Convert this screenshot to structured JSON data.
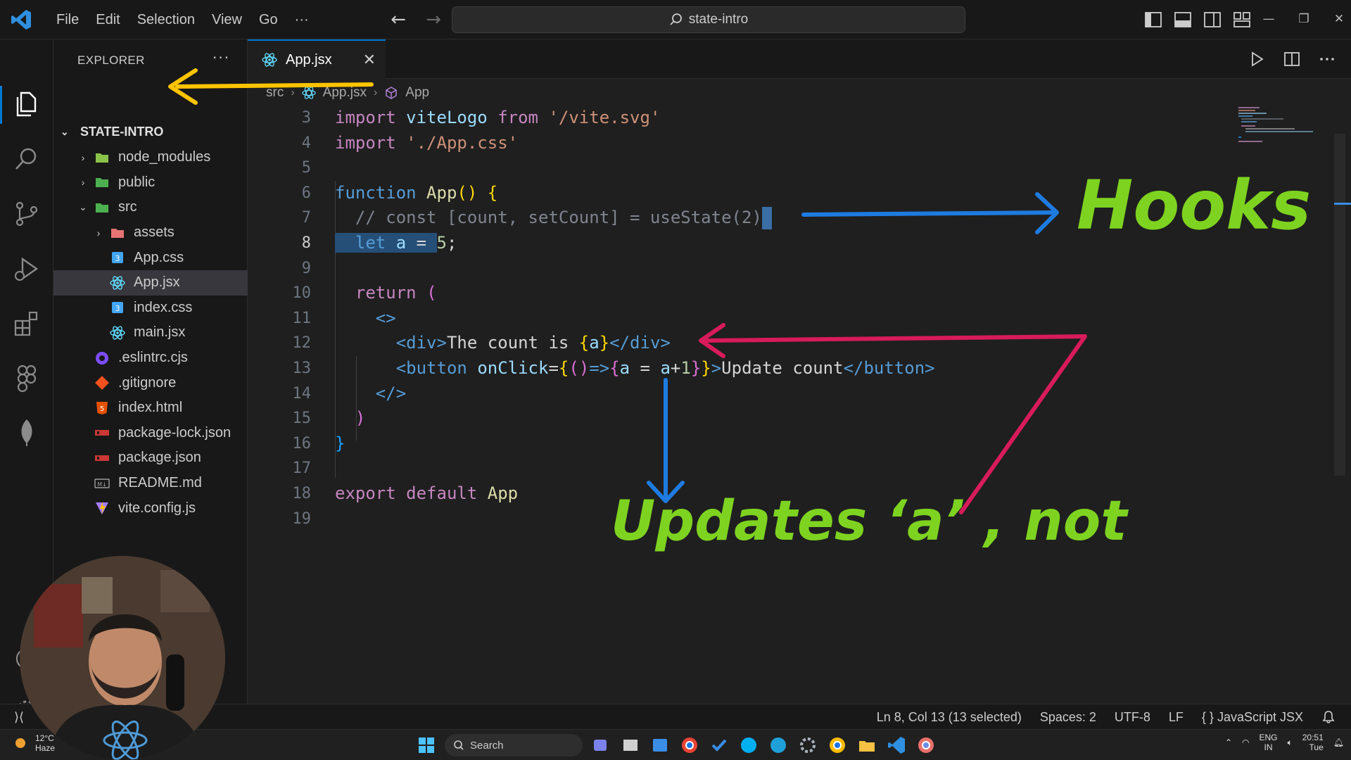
{
  "titlebar": {
    "menu": [
      "File",
      "Edit",
      "Selection",
      "View",
      "Go",
      "···"
    ],
    "search_text": "state-intro"
  },
  "explorer": {
    "title": "EXPLORER",
    "more": "···",
    "root": "STATE-INTRO",
    "items": [
      {
        "label": "node_modules",
        "kind": "folder",
        "depth": 1,
        "expanded": false,
        "icon": "node-modules-folder-icon"
      },
      {
        "label": "public",
        "kind": "folder",
        "depth": 1,
        "expanded": false,
        "icon": "public-folder-icon"
      },
      {
        "label": "src",
        "kind": "folder",
        "depth": 1,
        "expanded": true,
        "icon": "src-folder-icon"
      },
      {
        "label": "assets",
        "kind": "folder",
        "depth": 2,
        "expanded": false,
        "icon": "assets-folder-icon"
      },
      {
        "label": "App.css",
        "kind": "file",
        "depth": 2,
        "icon": "css-file-icon"
      },
      {
        "label": "App.jsx",
        "kind": "file",
        "depth": 2,
        "icon": "react-file-icon",
        "selected": true
      },
      {
        "label": "index.css",
        "kind": "file",
        "depth": 2,
        "icon": "css-file-icon"
      },
      {
        "label": "main.jsx",
        "kind": "file",
        "depth": 2,
        "icon": "react-file-icon"
      },
      {
        "label": ".eslintrc.cjs",
        "kind": "file",
        "depth": 1,
        "icon": "eslint-file-icon"
      },
      {
        "label": ".gitignore",
        "kind": "file",
        "depth": 1,
        "icon": "git-file-icon"
      },
      {
        "label": "index.html",
        "kind": "file",
        "depth": 1,
        "icon": "html-file-icon"
      },
      {
        "label": "package-lock.json",
        "kind": "file",
        "depth": 1,
        "icon": "npm-file-icon"
      },
      {
        "label": "package.json",
        "kind": "file",
        "depth": 1,
        "icon": "npm-file-icon"
      },
      {
        "label": "README.md",
        "kind": "file",
        "depth": 1,
        "icon": "markdown-file-icon"
      },
      {
        "label": "vite.config.js",
        "kind": "file",
        "depth": 1,
        "icon": "vite-file-icon"
      }
    ]
  },
  "tab": {
    "label": "App.jsx",
    "close": "✕"
  },
  "breadcrumb": [
    "src",
    "App.jsx",
    "App"
  ],
  "editor": {
    "line_numbers": [
      "3",
      "4",
      "5",
      "6",
      "7",
      "8",
      "9",
      "10",
      "11",
      "12",
      "13",
      "14",
      "15",
      "16",
      "17",
      "18",
      "19"
    ],
    "active_line": "8"
  },
  "annotations": {
    "hooks": "Hooks",
    "updates": "Updates ‘a’ , not"
  },
  "status": {
    "position": "Ln 8, Col 13 (13 selected)",
    "spaces": "Spaces: 2",
    "encoding": "UTF-8",
    "eol": "LF",
    "language": "{ }  JavaScript JSX"
  },
  "taskbar": {
    "temp": "12°C",
    "condition": "Haze",
    "search": "Search",
    "lang1": "ENG",
    "lang2": "IN",
    "time": "20:51",
    "day": "Tue"
  },
  "colors": {
    "accent": "#0078d4",
    "annotation_yellow": "#ffc400",
    "annotation_blue": "#1e7be0",
    "annotation_red": "#d81b5a",
    "annotation_green": "#7ed321"
  }
}
